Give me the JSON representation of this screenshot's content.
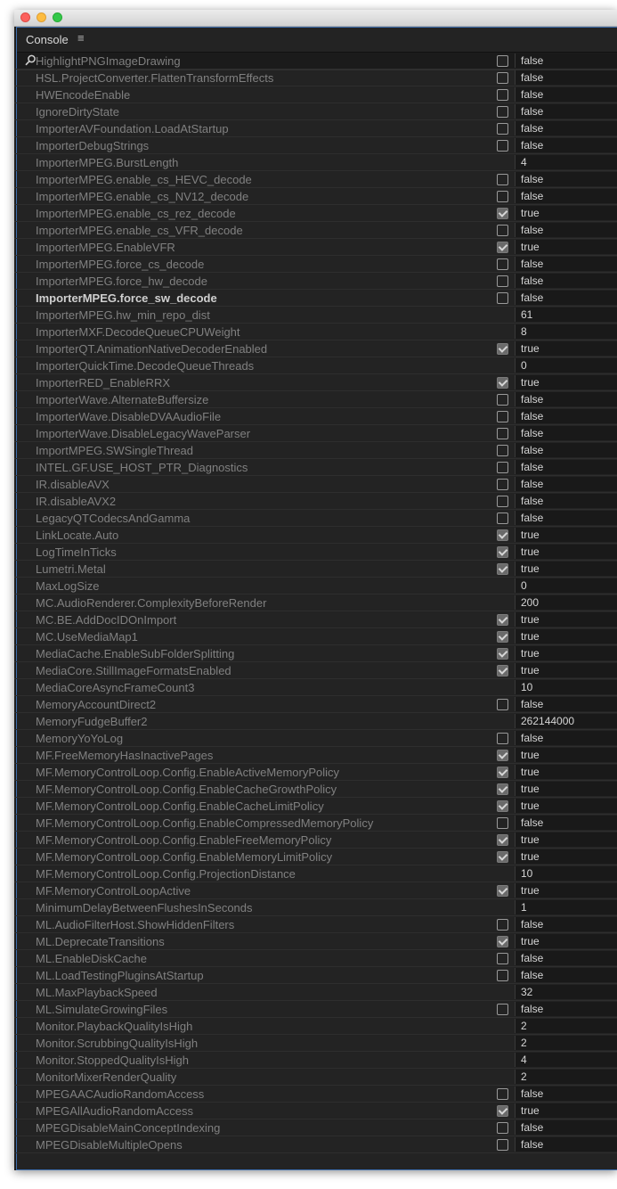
{
  "panel": {
    "title": "Console",
    "menu_icon": "hamburger-menu-icon"
  },
  "search": {
    "icon": "search-icon",
    "value": ""
  },
  "rows": [
    {
      "name": "HighlightPNGImageDrawing",
      "check": true,
      "checked": false,
      "value": "false"
    },
    {
      "name": "HSL.ProjectConverter.FlattenTransformEffects",
      "check": true,
      "checked": false,
      "value": "false"
    },
    {
      "name": "HWEncodeEnable",
      "check": true,
      "checked": false,
      "value": "false"
    },
    {
      "name": "IgnoreDirtyState",
      "check": true,
      "checked": false,
      "value": "false"
    },
    {
      "name": "ImporterAVFoundation.LoadAtStartup",
      "check": true,
      "checked": false,
      "value": "false"
    },
    {
      "name": "ImporterDebugStrings",
      "check": true,
      "checked": false,
      "value": "false"
    },
    {
      "name": "ImporterMPEG.BurstLength",
      "check": false,
      "checked": false,
      "value": "4"
    },
    {
      "name": "ImporterMPEG.enable_cs_HEVC_decode",
      "check": true,
      "checked": false,
      "value": "false"
    },
    {
      "name": "ImporterMPEG.enable_cs_NV12_decode",
      "check": true,
      "checked": false,
      "value": "false"
    },
    {
      "name": "ImporterMPEG.enable_cs_rez_decode",
      "check": true,
      "checked": true,
      "value": "true"
    },
    {
      "name": "ImporterMPEG.enable_cs_VFR_decode",
      "check": true,
      "checked": false,
      "value": "false"
    },
    {
      "name": "ImporterMPEG.EnableVFR",
      "check": true,
      "checked": true,
      "value": "true"
    },
    {
      "name": "ImporterMPEG.force_cs_decode",
      "check": true,
      "checked": false,
      "value": "false"
    },
    {
      "name": "ImporterMPEG.force_hw_decode",
      "check": true,
      "checked": false,
      "value": "false"
    },
    {
      "name": "ImporterMPEG.force_sw_decode",
      "check": true,
      "checked": false,
      "value": "false",
      "bold": true
    },
    {
      "name": "ImporterMPEG.hw_min_repo_dist",
      "check": false,
      "checked": false,
      "value": "61"
    },
    {
      "name": "ImporterMXF.DecodeQueueCPUWeight",
      "check": false,
      "checked": false,
      "value": "8"
    },
    {
      "name": "ImporterQT.AnimationNativeDecoderEnabled",
      "check": true,
      "checked": true,
      "value": "true"
    },
    {
      "name": "ImporterQuickTime.DecodeQueueThreads",
      "check": false,
      "checked": false,
      "value": "0"
    },
    {
      "name": "ImporterRED_EnableRRX",
      "check": true,
      "checked": true,
      "value": "true"
    },
    {
      "name": "ImporterWave.AlternateBuffersize",
      "check": true,
      "checked": false,
      "value": "false"
    },
    {
      "name": "ImporterWave.DisableDVAAudioFile",
      "check": true,
      "checked": false,
      "value": "false"
    },
    {
      "name": "ImporterWave.DisableLegacyWaveParser",
      "check": true,
      "checked": false,
      "value": "false"
    },
    {
      "name": "ImportMPEG.SWSingleThread",
      "check": true,
      "checked": false,
      "value": "false"
    },
    {
      "name": "INTEL.GF.USE_HOST_PTR_Diagnostics",
      "check": true,
      "checked": false,
      "value": "false"
    },
    {
      "name": "IR.disableAVX",
      "check": true,
      "checked": false,
      "value": "false"
    },
    {
      "name": "IR.disableAVX2",
      "check": true,
      "checked": false,
      "value": "false"
    },
    {
      "name": "LegacyQTCodecsAndGamma",
      "check": true,
      "checked": false,
      "value": "false"
    },
    {
      "name": "LinkLocate.Auto",
      "check": true,
      "checked": true,
      "value": "true"
    },
    {
      "name": "LogTimeInTicks",
      "check": true,
      "checked": true,
      "value": "true"
    },
    {
      "name": "Lumetri.Metal",
      "check": true,
      "checked": true,
      "value": "true"
    },
    {
      "name": "MaxLogSize",
      "check": false,
      "checked": false,
      "value": "0"
    },
    {
      "name": "MC.AudioRenderer.ComplexityBeforeRender",
      "check": false,
      "checked": false,
      "value": "200"
    },
    {
      "name": "MC.BE.AddDocIDOnImport",
      "check": true,
      "checked": true,
      "value": "true"
    },
    {
      "name": "MC.UseMediaMap1",
      "check": true,
      "checked": true,
      "value": "true"
    },
    {
      "name": "MediaCache.EnableSubFolderSplitting",
      "check": true,
      "checked": true,
      "value": "true"
    },
    {
      "name": "MediaCore.StillImageFormatsEnabled",
      "check": true,
      "checked": true,
      "value": "true"
    },
    {
      "name": "MediaCoreAsyncFrameCount3",
      "check": false,
      "checked": false,
      "value": "10"
    },
    {
      "name": "MemoryAccountDirect2",
      "check": true,
      "checked": false,
      "value": "false"
    },
    {
      "name": "MemoryFudgeBuffer2",
      "check": false,
      "checked": false,
      "value": "262144000"
    },
    {
      "name": "MemoryYoYoLog",
      "check": true,
      "checked": false,
      "value": "false"
    },
    {
      "name": "MF.FreeMemoryHasInactivePages",
      "check": true,
      "checked": true,
      "value": "true"
    },
    {
      "name": "MF.MemoryControlLoop.Config.EnableActiveMemoryPolicy",
      "check": true,
      "checked": true,
      "value": "true"
    },
    {
      "name": "MF.MemoryControlLoop.Config.EnableCacheGrowthPolicy",
      "check": true,
      "checked": true,
      "value": "true"
    },
    {
      "name": "MF.MemoryControlLoop.Config.EnableCacheLimitPolicy",
      "check": true,
      "checked": true,
      "value": "true"
    },
    {
      "name": "MF.MemoryControlLoop.Config.EnableCompressedMemoryPolicy",
      "check": true,
      "checked": false,
      "value": "false"
    },
    {
      "name": "MF.MemoryControlLoop.Config.EnableFreeMemoryPolicy",
      "check": true,
      "checked": true,
      "value": "true"
    },
    {
      "name": "MF.MemoryControlLoop.Config.EnableMemoryLimitPolicy",
      "check": true,
      "checked": true,
      "value": "true"
    },
    {
      "name": "MF.MemoryControlLoop.Config.ProjectionDistance",
      "check": false,
      "checked": false,
      "value": "10"
    },
    {
      "name": "MF.MemoryControlLoopActive",
      "check": true,
      "checked": true,
      "value": "true"
    },
    {
      "name": "MinimumDelayBetweenFlushesInSeconds",
      "check": false,
      "checked": false,
      "value": "1"
    },
    {
      "name": "ML.AudioFilterHost.ShowHiddenFilters",
      "check": true,
      "checked": false,
      "value": "false"
    },
    {
      "name": "ML.DeprecateTransitions",
      "check": true,
      "checked": true,
      "value": "true"
    },
    {
      "name": "ML.EnableDiskCache",
      "check": true,
      "checked": false,
      "value": "false"
    },
    {
      "name": "ML.LoadTestingPluginsAtStartup",
      "check": true,
      "checked": false,
      "value": "false"
    },
    {
      "name": "ML.MaxPlaybackSpeed",
      "check": false,
      "checked": false,
      "value": "32"
    },
    {
      "name": "ML.SimulateGrowingFiles",
      "check": true,
      "checked": false,
      "value": "false"
    },
    {
      "name": "Monitor.PlaybackQualityIsHigh",
      "check": false,
      "checked": false,
      "value": "2"
    },
    {
      "name": "Monitor.ScrubbingQualityIsHigh",
      "check": false,
      "checked": false,
      "value": "2"
    },
    {
      "name": "Monitor.StoppedQualityIsHigh",
      "check": false,
      "checked": false,
      "value": "4"
    },
    {
      "name": "MonitorMixerRenderQuality",
      "check": false,
      "checked": false,
      "value": "2"
    },
    {
      "name": "MPEGAACAudioRandomAccess",
      "check": true,
      "checked": false,
      "value": "false"
    },
    {
      "name": "MPEGAllAudioRandomAccess",
      "check": true,
      "checked": true,
      "value": "true"
    },
    {
      "name": "MPEGDisableMainConceptIndexing",
      "check": true,
      "checked": false,
      "value": "false"
    },
    {
      "name": "MPEGDisableMultipleOpens",
      "check": true,
      "checked": false,
      "value": "false"
    }
  ]
}
